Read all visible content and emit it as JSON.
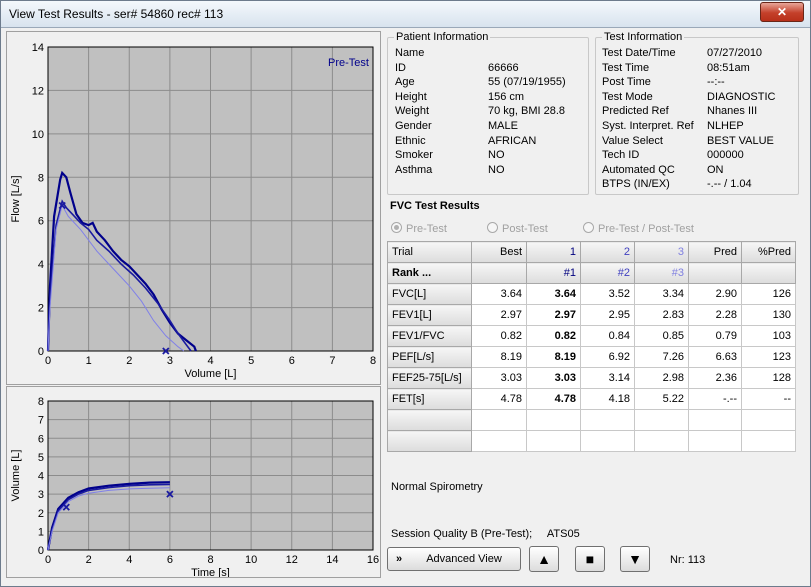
{
  "window": {
    "title": "View Test Results - ser# 54860 rec# 113",
    "close": "✕"
  },
  "patient": {
    "group_label": "Patient Information",
    "rows": [
      {
        "label": "Name",
        "value": ""
      },
      {
        "label": "ID",
        "value": "66666"
      },
      {
        "label": "Age",
        "value": "55 (07/19/1955)"
      },
      {
        "label": "Height",
        "value": "156 cm"
      },
      {
        "label": "Weight",
        "value": "70 kg, BMI 28.8"
      },
      {
        "label": "Gender",
        "value": "MALE"
      },
      {
        "label": "Ethnic",
        "value": "AFRICAN"
      },
      {
        "label": "Smoker",
        "value": "NO"
      },
      {
        "label": "Asthma",
        "value": "NO"
      }
    ]
  },
  "test": {
    "group_label": "Test Information",
    "rows": [
      {
        "label": "Test Date/Time",
        "value": "07/27/2010"
      },
      {
        "label": "Test Time",
        "value": "08:51am"
      },
      {
        "label": "Post Time",
        "value": "--:--"
      },
      {
        "label": "Test Mode",
        "value": "DIAGNOSTIC"
      },
      {
        "label": "Predicted Ref",
        "value": "Nhanes III"
      },
      {
        "label": "Syst. Interpret. Ref",
        "value": "NLHEP"
      },
      {
        "label": "Value Select",
        "value": "BEST VALUE"
      },
      {
        "label": "Tech ID",
        "value": "000000"
      },
      {
        "label": "Automated QC",
        "value": "ON"
      },
      {
        "label": "BTPS (IN/EX)",
        "value": "-.-- / 1.04"
      }
    ]
  },
  "fvc": {
    "title": "FVC Test Results",
    "radios": [
      {
        "label": "Pre-Test",
        "selected": true
      },
      {
        "label": "Post-Test",
        "selected": false
      },
      {
        "label": "Pre-Test / Post-Test",
        "selected": false
      }
    ],
    "columns": [
      "Trial",
      "Best",
      "1",
      "2",
      "3",
      "Pred",
      "%Pred"
    ],
    "rank": {
      "label": "Rank ...",
      "values": [
        "",
        "#1",
        "#2",
        "#3",
        "",
        ""
      ]
    },
    "rows": [
      {
        "label": "FVC[L]",
        "values": [
          "3.64",
          "3.64",
          "3.52",
          "3.34",
          "2.90",
          "126"
        ]
      },
      {
        "label": "FEV1[L]",
        "values": [
          "2.97",
          "2.97",
          "2.95",
          "2.83",
          "2.28",
          "130"
        ]
      },
      {
        "label": "FEV1/FVC",
        "values": [
          "0.82",
          "0.82",
          "0.84",
          "0.85",
          "0.79",
          "103"
        ]
      },
      {
        "label": "PEF[L/s]",
        "values": [
          "8.19",
          "8.19",
          "6.92",
          "7.26",
          "6.63",
          "123"
        ]
      },
      {
        "label": "FEF25-75[L/s]",
        "values": [
          "3.03",
          "3.03",
          "3.14",
          "2.98",
          "2.36",
          "128"
        ]
      },
      {
        "label": "FET[s]",
        "values": [
          "4.78",
          "4.78",
          "4.18",
          "5.22",
          "-.--",
          "--"
        ]
      }
    ],
    "interpretation": "Normal Spirometry",
    "session_quality": "Session Quality B (Pre-Test);     ATS05"
  },
  "controls": {
    "advanced_view": "Advanced View",
    "advanced_icon": "»",
    "up": "▲",
    "stop": "■",
    "down": "▼",
    "nr": "Nr: 113"
  },
  "chart_data": [
    {
      "type": "line",
      "title": "",
      "legend": "Pre-Test",
      "xlabel": "Volume [L]",
      "ylabel": "Flow [L/s]",
      "xlim": [
        0,
        8
      ],
      "ylim": [
        0,
        14
      ],
      "xticks": [
        0,
        1,
        2,
        3,
        4,
        5,
        6,
        7,
        8
      ],
      "yticks": [
        0,
        2,
        4,
        6,
        8,
        10,
        12,
        14
      ],
      "grid": true,
      "series": [
        {
          "values": [
            [
              0,
              0
            ],
            [
              0.05,
              3
            ],
            [
              0.15,
              6.2
            ],
            [
              0.3,
              7.9
            ],
            [
              0.35,
              8.2
            ],
            [
              0.45,
              8.0
            ],
            [
              0.55,
              7.3
            ],
            [
              0.7,
              6.3
            ],
            [
              0.85,
              5.9
            ],
            [
              1.0,
              5.8
            ],
            [
              1.1,
              5.9
            ],
            [
              1.2,
              5.5
            ],
            [
              1.4,
              5.1
            ],
            [
              1.6,
              4.6
            ],
            [
              1.8,
              4.2
            ],
            [
              2.0,
              3.9
            ],
            [
              2.2,
              3.5
            ],
            [
              2.4,
              3.1
            ],
            [
              2.6,
              2.6
            ],
            [
              2.8,
              1.9
            ],
            [
              3.0,
              1.3
            ],
            [
              3.2,
              0.8
            ],
            [
              3.4,
              0.5
            ],
            [
              3.6,
              0.2
            ],
            [
              3.64,
              0
            ]
          ]
        },
        {
          "values": [
            [
              0,
              0
            ],
            [
              0.05,
              2.5
            ],
            [
              0.2,
              5.8
            ],
            [
              0.35,
              6.9
            ],
            [
              0.45,
              6.6
            ],
            [
              0.6,
              6.3
            ],
            [
              0.8,
              5.9
            ],
            [
              1.0,
              5.6
            ],
            [
              1.2,
              5.1
            ],
            [
              1.5,
              4.6
            ],
            [
              1.8,
              4.0
            ],
            [
              2.1,
              3.5
            ],
            [
              2.4,
              2.9
            ],
            [
              2.7,
              2.2
            ],
            [
              3.0,
              1.4
            ],
            [
              3.2,
              0.8
            ],
            [
              3.4,
              0.3
            ],
            [
              3.52,
              0
            ]
          ]
        },
        {
          "values": [
            [
              0,
              0
            ],
            [
              0.05,
              2
            ],
            [
              0.2,
              5.6
            ],
            [
              0.35,
              6.7
            ],
            [
              0.5,
              6.2
            ],
            [
              0.8,
              5.6
            ],
            [
              1.2,
              4.6
            ],
            [
              1.6,
              3.8
            ],
            [
              2.0,
              3.0
            ],
            [
              2.3,
              2.3
            ],
            [
              2.6,
              1.4
            ],
            [
              2.9,
              0.7
            ],
            [
              3.2,
              0.2
            ],
            [
              3.34,
              0
            ]
          ]
        }
      ],
      "markers": [
        [
          0.35,
          6.7
        ],
        [
          2.9,
          0
        ]
      ]
    },
    {
      "type": "line",
      "title": "",
      "xlabel": "Time [s]",
      "ylabel": "Volume [L]",
      "xlim": [
        0,
        16
      ],
      "ylim": [
        0,
        8
      ],
      "xticks": [
        0,
        2,
        4,
        6,
        8,
        10,
        12,
        14,
        16
      ],
      "yticks": [
        0,
        1,
        2,
        3,
        4,
        5,
        6,
        7,
        8
      ],
      "grid": true,
      "series": [
        {
          "values": [
            [
              0,
              0
            ],
            [
              0.2,
              1.2
            ],
            [
              0.5,
              2.2
            ],
            [
              1,
              2.8
            ],
            [
              1.5,
              3.1
            ],
            [
              2,
              3.3
            ],
            [
              3,
              3.45
            ],
            [
              4,
              3.55
            ],
            [
              5,
              3.62
            ],
            [
              6,
              3.64
            ]
          ]
        },
        {
          "values": [
            [
              0,
              0
            ],
            [
              0.2,
              1.1
            ],
            [
              0.5,
              2.1
            ],
            [
              1,
              2.7
            ],
            [
              1.5,
              3.0
            ],
            [
              2,
              3.2
            ],
            [
              3,
              3.35
            ],
            [
              4,
              3.45
            ],
            [
              5,
              3.5
            ],
            [
              6,
              3.52
            ]
          ]
        },
        {
          "values": [
            [
              0,
              0
            ],
            [
              0.2,
              1.0
            ],
            [
              0.5,
              2.0
            ],
            [
              1,
              2.6
            ],
            [
              1.5,
              2.9
            ],
            [
              2,
              3.05
            ],
            [
              3,
              3.2
            ],
            [
              4,
              3.28
            ],
            [
              5,
              3.32
            ],
            [
              6,
              3.34
            ]
          ]
        }
      ],
      "markers": [
        [
          0.9,
          2.3
        ],
        [
          6.0,
          3.0
        ]
      ]
    }
  ]
}
